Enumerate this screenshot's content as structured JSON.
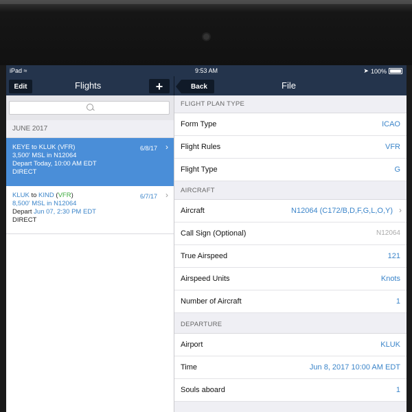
{
  "status": {
    "left": "iPad",
    "time": "9:53 AM",
    "battery": "100%"
  },
  "nav_left": {
    "edit_label": "Edit",
    "title": "Flights",
    "add_label": "+"
  },
  "nav_right": {
    "back_label": "Back",
    "title": "File"
  },
  "search": {
    "placeholder": ""
  },
  "list_section": "JUNE 2017",
  "flights": [
    {
      "from": "KEYE",
      "to_word": "to",
      "to": "KLUK",
      "rules": "(VFR)",
      "date": "6/8/17",
      "alt": "3,500' MSL",
      "in_word": "in",
      "aircraft": "N12064",
      "depart_word": "Depart",
      "depart": "Today, 10:00 AM EDT",
      "route": "DIRECT"
    },
    {
      "from": "KLUK",
      "to_word": "to",
      "to": "KIND",
      "rules_open": "(",
      "rules": "VFR",
      "rules_close": ")",
      "date": "6/7/17",
      "alt": "8,500' MSL",
      "in_word": "in",
      "aircraft": "N12064",
      "depart_word": "Depart",
      "depart": "Jun 07, 2:30 PM EDT",
      "route": "DIRECT"
    }
  ],
  "sections": {
    "flight_plan_type": "FLIGHT PLAN TYPE",
    "aircraft": "AIRCRAFT",
    "departure": "DEPARTURE"
  },
  "rows": {
    "form_type": {
      "label": "Form Type",
      "value": "ICAO"
    },
    "flight_rules": {
      "label": "Flight Rules",
      "value": "VFR"
    },
    "flight_type": {
      "label": "Flight Type",
      "value": "G"
    },
    "aircraft": {
      "label": "Aircraft",
      "value": "N12064 (C172/B,D,F,G,L,O,Y)"
    },
    "call_sign": {
      "label": "Call Sign (Optional)",
      "placeholder": "N12064"
    },
    "true_airspeed": {
      "label": "True Airspeed",
      "value": "121"
    },
    "airspeed_units": {
      "label": "Airspeed Units",
      "value": "Knots"
    },
    "num_aircraft": {
      "label": "Number of Aircraft",
      "value": "1"
    },
    "airport": {
      "label": "Airport",
      "value": "KLUK"
    },
    "time": {
      "label": "Time",
      "value": "Jun 8, 2017 10:00 AM EDT"
    },
    "souls": {
      "label": "Souls aboard",
      "value": "1"
    }
  }
}
